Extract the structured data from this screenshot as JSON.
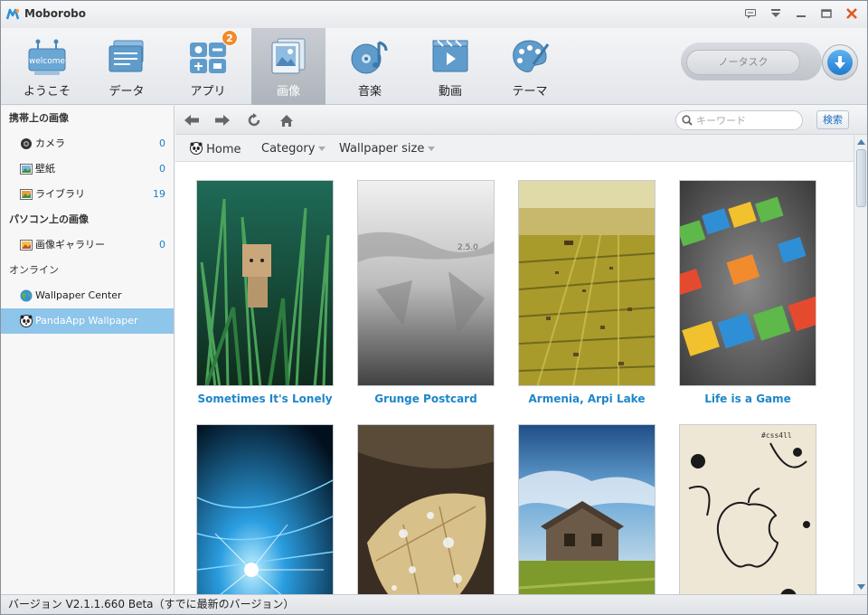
{
  "window": {
    "title": "Moborobo"
  },
  "nav_tabs": [
    {
      "label": "ようこそ",
      "icon": "welcome-icon",
      "icon_text": "welcome"
    },
    {
      "label": "データ",
      "icon": "data-icon"
    },
    {
      "label": "アプリ",
      "icon": "apps-icon",
      "badge": "2"
    },
    {
      "label": "画像",
      "icon": "images-icon",
      "active": true
    },
    {
      "label": "音楽",
      "icon": "music-icon"
    },
    {
      "label": "動画",
      "icon": "video-icon"
    },
    {
      "label": "テーマ",
      "icon": "theme-icon"
    }
  ],
  "task": {
    "label": "ノータスク"
  },
  "sidebar": {
    "phone_section": "携帯上の画像",
    "phone_items": [
      {
        "label": "カメラ",
        "count": "0",
        "icon": "camera-icon"
      },
      {
        "label": "壁紙",
        "count": "0",
        "icon": "wallpaper-icon"
      },
      {
        "label": "ライブラリ",
        "count": "19",
        "icon": "library-icon"
      }
    ],
    "pc_section": "パソコン上の画像",
    "pc_items": [
      {
        "label": "画像ギャラリー",
        "count": "0",
        "icon": "gallery-icon"
      }
    ],
    "online_section": "オンライン",
    "online_items": [
      {
        "label": "Wallpaper Center",
        "icon": "globe-icon"
      },
      {
        "label": "PandaApp Wallpaper",
        "icon": "panda-icon",
        "selected": true
      }
    ]
  },
  "search": {
    "placeholder": "キーワード",
    "button": "検索"
  },
  "filters": {
    "home": "Home",
    "category": "Category",
    "size": "Wallpaper size"
  },
  "wallpapers": [
    {
      "title": "Sometimes It's Lonely"
    },
    {
      "title": "Grunge Postcard"
    },
    {
      "title": "Armenia, Arpi Lake"
    },
    {
      "title": "Life is a Game"
    },
    {
      "title": ""
    },
    {
      "title": ""
    },
    {
      "title": ""
    },
    {
      "title": ""
    }
  ],
  "status": {
    "text": "バージョン V2.1.1.660 Beta（すでに最新のバージョン）"
  },
  "colors": {
    "accent": "#1e86c9",
    "selected": "#8ec5ea",
    "badge": "#f08a2c"
  }
}
